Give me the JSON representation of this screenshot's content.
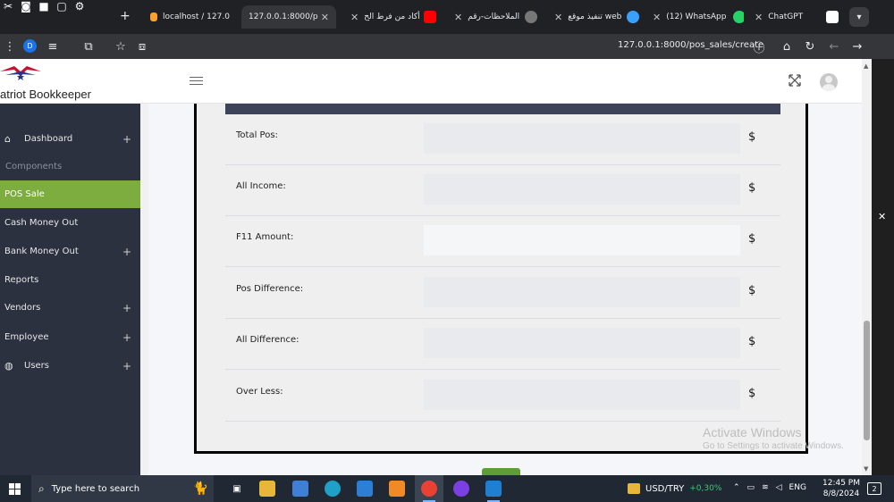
{
  "browser": {
    "tabs": [
      {
        "title": "localhost / 127.0"
      },
      {
        "title": "127.0.0.1:8000/p"
      },
      {
        "title": "أكاد من فرط الح"
      },
      {
        "title": "الملاحظات-رقم"
      },
      {
        "title": "تنفيذ موقع web"
      },
      {
        "title": "(12) WhatsApp"
      },
      {
        "title": "ChatGPT"
      }
    ],
    "active_tab_index": 1,
    "url": "127.0.0.1:8000/pos_sales/create",
    "profile_letter": "D"
  },
  "app": {
    "brand": "atriot Bookkeeper"
  },
  "sidebar": {
    "items": [
      {
        "label": "Dashboard",
        "icon": "home-icon",
        "expandable": true
      },
      {
        "label": "POS Sale",
        "active": true
      },
      {
        "label": "Cash Money Out"
      },
      {
        "label": "Bank Money Out",
        "expandable": true
      },
      {
        "label": "Reports"
      },
      {
        "label": "Vendors",
        "expandable": true
      },
      {
        "label": "Employee",
        "expandable": true
      },
      {
        "label": "Users",
        "icon": "palette-icon",
        "expandable": true
      }
    ],
    "heading": "Components"
  },
  "form": {
    "currency": "$",
    "rows": [
      {
        "label": "Total Pos:",
        "value": ""
      },
      {
        "label": "All Income:",
        "value": ""
      },
      {
        "label": "F11 Amount:",
        "value": "",
        "editable": true
      },
      {
        "label": "Pos Difference:",
        "value": ""
      },
      {
        "label": "All Difference:",
        "value": ""
      },
      {
        "label": "Over Less:",
        "value": ""
      }
    ]
  },
  "watermark": {
    "line1": "Activate Windows",
    "line2": "Go to Settings to activate Windows."
  },
  "taskbar": {
    "search_placeholder": "Type here to search",
    "ticker_symbol": "USD/TRY",
    "ticker_change": "+0,30%",
    "language": "ENG",
    "time": "12:45 PM",
    "date": "8/8/2024",
    "notification_count": "2"
  },
  "colors": {
    "sidebar_bg": "#2c3140",
    "sidebar_active": "#7cad3e",
    "card_header": "#3d4359"
  }
}
